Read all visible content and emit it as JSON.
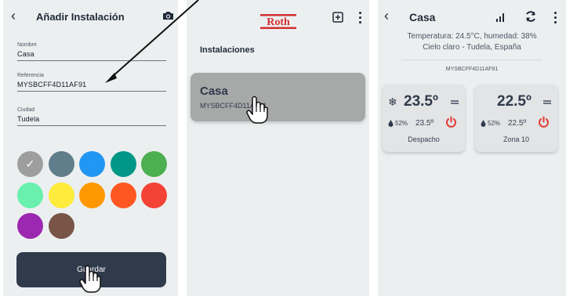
{
  "screen1": {
    "header": {
      "back_glyph": "‹",
      "title": "Añadir Instalación",
      "camera_icon": "camera-icon"
    },
    "fields": [
      {
        "label": "Nombre",
        "value": "Casa"
      },
      {
        "label": "Referencia",
        "value": "MYSBCFF4D11AF91"
      },
      {
        "label": "Ciudad",
        "value": "Tudela"
      }
    ],
    "colors": [
      "#9e9e9e",
      "#607d8b",
      "#2196f3",
      "#009688",
      "#4caf50",
      "#69f0ae",
      "#ffeb3b",
      "#ff9800",
      "#ff5722",
      "#f44336",
      "#9c27b0",
      "#795548"
    ],
    "selected_color_index": 0,
    "check_glyph": "✓",
    "save_label": "Guardar"
  },
  "screen2": {
    "logo_text": "Roth",
    "section_title": "Instalaciones",
    "installation": {
      "name": "Casa",
      "reference": "MYSBCFF4D11AF91"
    }
  },
  "screen3": {
    "header": {
      "back_glyph": "‹",
      "title": "Casa"
    },
    "weather_line1": "Temperatura: 24.5°C, humedad: 38%",
    "weather_line2": "Cielo claro - Tudela, España",
    "reference": "MYSBCFF4D11AF91",
    "zones": [
      {
        "name": "Despacho",
        "temperature": "23.5º",
        "humidity": "52%",
        "setpoint": "23.5º",
        "mode_icon": "snowflake-icon"
      },
      {
        "name": "Zona 10",
        "temperature": "22.5º",
        "humidity": "52%",
        "setpoint": "22.5º",
        "mode_icon": ""
      }
    ]
  },
  "colors": {
    "accent_dark": "#2f3a4b",
    "roth_red": "#d32f2f",
    "power_red": "#e53935",
    "background": "#eceff0"
  }
}
